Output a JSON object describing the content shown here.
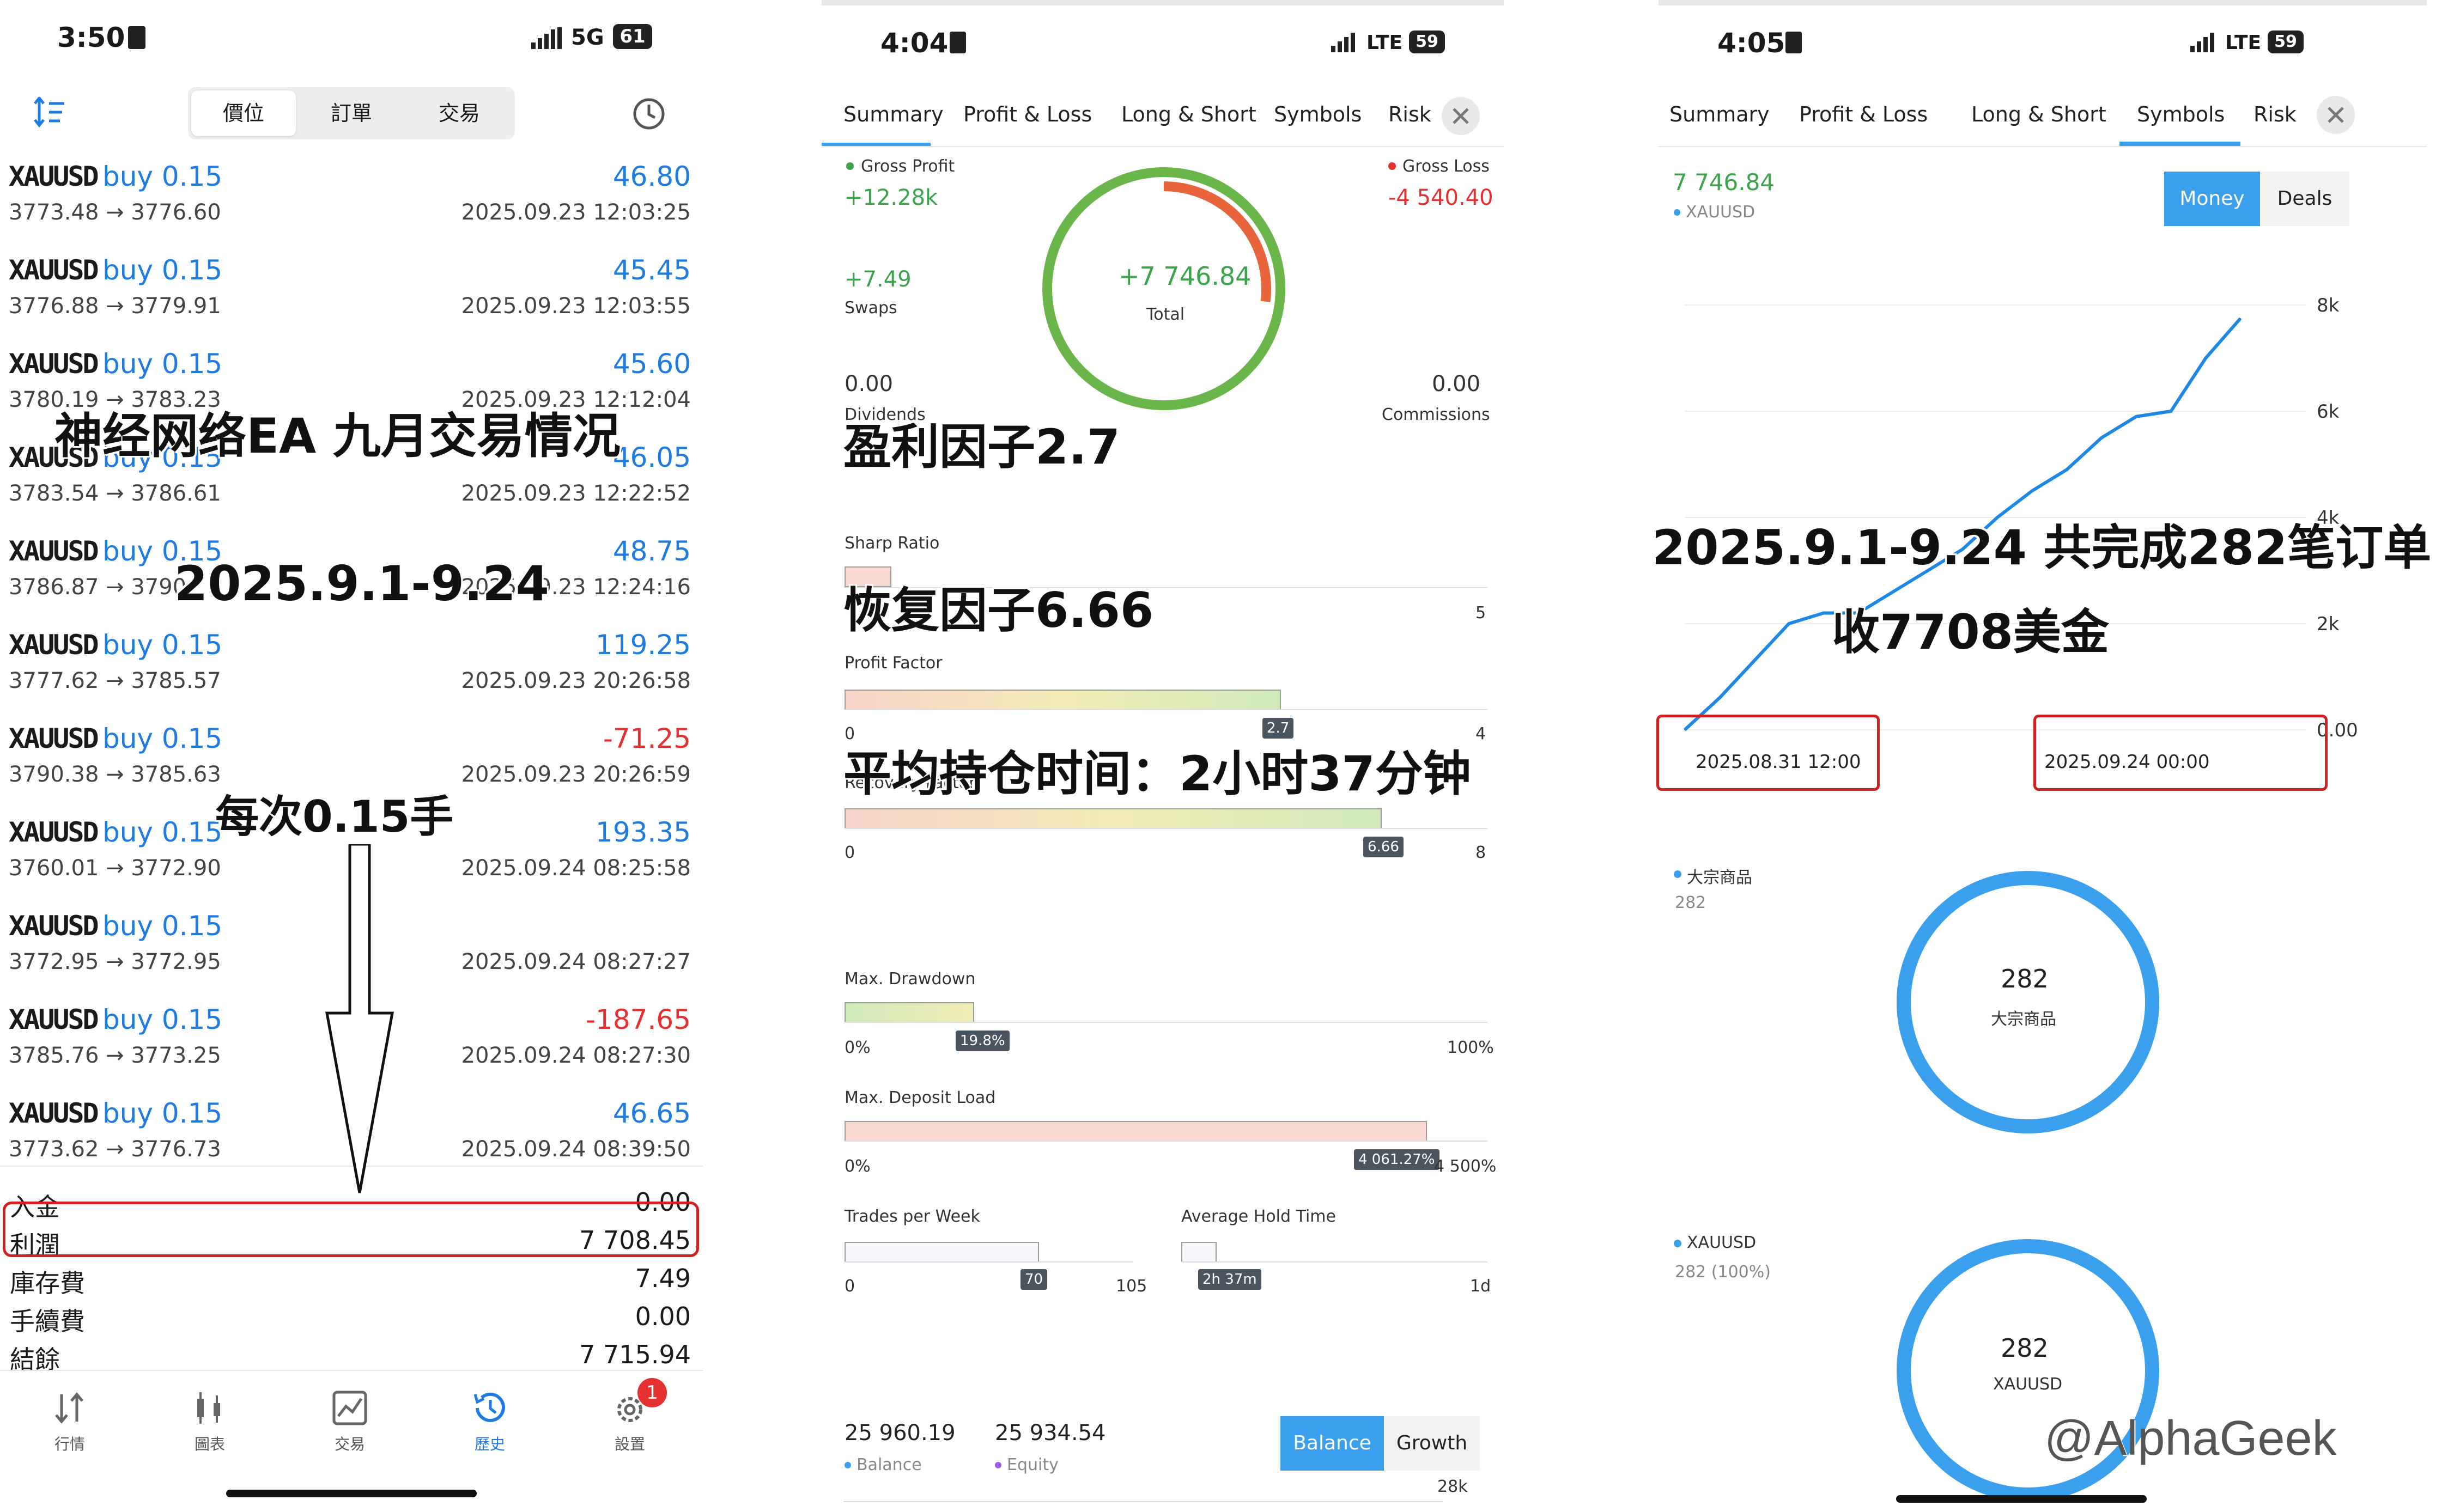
{
  "panel1": {
    "status": {
      "time": "3:50",
      "network": "5G",
      "battery": "61"
    },
    "segments": [
      "價位",
      "訂單",
      "交易"
    ],
    "trades": [
      {
        "symbol": "XAUUSD",
        "dir": "buy 0.15",
        "prices": "3773.48 → 3776.60",
        "profit": "46.80",
        "time": "2025.09.23 12:03:25",
        "neg": false
      },
      {
        "symbol": "XAUUSD",
        "dir": "buy 0.15",
        "prices": "3776.88 → 3779.91",
        "profit": "45.45",
        "time": "2025.09.23 12:03:55",
        "neg": false
      },
      {
        "symbol": "XAUUSD",
        "dir": "buy 0.15",
        "prices": "3780.19 → 3783.23",
        "profit": "45.60",
        "time": "2025.09.23 12:12:04",
        "neg": false
      },
      {
        "symbol": "XAUUSD",
        "dir": "buy 0.15",
        "prices": "3783.54 → 3786.61",
        "profit": "46.05",
        "time": "2025.09.23 12:22:52",
        "neg": false
      },
      {
        "symbol": "XAUUSD",
        "dir": "buy 0.15",
        "prices": "3786.87 → 3790.",
        "profit": "48.75",
        "time": "2025.09.23 12:24:16",
        "neg": false
      },
      {
        "symbol": "XAUUSD",
        "dir": "buy 0.15",
        "prices": "3777.62 → 3785.57",
        "profit": "119.25",
        "time": "2025.09.23 20:26:58",
        "neg": false
      },
      {
        "symbol": "XAUUSD",
        "dir": "buy 0.15",
        "prices": "3790.38 → 3785.63",
        "profit": "-71.25",
        "time": "2025.09.23 20:26:59",
        "neg": true
      },
      {
        "symbol": "XAUUSD",
        "dir": "buy 0.15",
        "prices": "3760.01 → 3772.90",
        "profit": "193.35",
        "time": "2025.09.24 08:25:58",
        "neg": false
      },
      {
        "symbol": "XAUUSD",
        "dir": "buy 0.15",
        "prices": "3772.95 → 3772.95",
        "profit": "",
        "time": "2025.09.24 08:27:27",
        "neg": false
      },
      {
        "symbol": "XAUUSD",
        "dir": "buy 0.15",
        "prices": "3785.76 → 3773.25",
        "profit": "-187.65",
        "time": "2025.09.24 08:27:30",
        "neg": true
      },
      {
        "symbol": "XAUUSD",
        "dir": "buy 0.15",
        "prices": "3773.62 → 3776.73",
        "profit": "46.65",
        "time": "2025.09.24 08:39:50",
        "neg": false
      }
    ],
    "summary": [
      {
        "label": "入金",
        "value": "0.00"
      },
      {
        "label": "利潤",
        "value": "7 708.45"
      },
      {
        "label": "庫存費",
        "value": "7.49"
      },
      {
        "label": "手續費",
        "value": "0.00"
      },
      {
        "label": "結餘",
        "value": "7 715.94"
      }
    ],
    "nav": [
      "行情",
      "圖表",
      "交易",
      "歷史",
      "設置"
    ],
    "nav_badge": "1",
    "overlay_title": "神经网络EA 九月交易情况",
    "overlay_dates": "2025.9.1-9.24",
    "overlay_lots": "每次0.15手"
  },
  "panel2": {
    "status": {
      "time": "4:04",
      "network": "LTE",
      "battery": "59"
    },
    "tabs": [
      "Summary",
      "Profit & Loss",
      "Long & Short",
      "Symbols",
      "Risk"
    ],
    "gross_profit_label": "Gross Profit",
    "gross_profit": "+12.28k",
    "gross_loss_label": "Gross Loss",
    "gross_loss": "-4 540.40",
    "swaps": "+7.49",
    "swaps_label": "Swaps",
    "dividends": "0.00",
    "dividends_label": "Dividends",
    "commissions": "0.00",
    "commissions_label": "Commissions",
    "total": "+7 746.84",
    "total_label": "Total",
    "sharp_label": "Sharp Ratio",
    "sharp_max": "5",
    "pf_label": "Profit Factor",
    "pf_value": "2.7",
    "pf_min": "0",
    "pf_max": "4",
    "rf_label": "Recovery Factor",
    "rf_value": "6.66",
    "rf_min": "0",
    "rf_max": "8",
    "dd_label": "Max. Drawdown",
    "dd_value": "19.8%",
    "dd_min": "0%",
    "dd_max": "100%",
    "dl_label": "Max. Deposit Load",
    "dl_value": "4 061.27%",
    "dl_min": "0%",
    "dl_max": "4 500%",
    "tpw_label": "Trades per Week",
    "tpw_value": "70",
    "tpw_min": "0",
    "tpw_max": "105",
    "aht_label": "Average Hold Time",
    "aht_value": "2h 37m",
    "aht_max": "1d",
    "balance": "25 960.19",
    "balance_label": "Balance",
    "equity": "25 934.54",
    "equity_label": "Equity",
    "btn_balance": "Balance",
    "btn_growth": "Growth",
    "axis_28k": "28k",
    "overlay_pf": "盈利因子2.7",
    "overlay_rf": "恢复因子6.66",
    "overlay_hold": "平均持仓时间：2小时37分钟",
    "levels": {
      "pf": 0.675,
      "rf": 0.8325,
      "dd": 0.198,
      "dl": 0.9025,
      "tpw": 0.6667,
      "aht": 0.109,
      "loss_arc": 0.27
    }
  },
  "panel3": {
    "status": {
      "time": "4:05",
      "network": "LTE",
      "battery": "59"
    },
    "tabs": [
      "Summary",
      "Profit & Loss",
      "Long & Short",
      "Symbols",
      "Risk"
    ],
    "value": "7 746.84",
    "legend": "XAUUSD",
    "btn_money": "Money",
    "btn_deals": "Deals",
    "y_ticks": [
      "8k",
      "6k",
      "4k",
      "2k",
      "0.00"
    ],
    "x_start": "2025.08.31 12:00",
    "x_end": "2025.09.24 00:00",
    "donut1_legend": "大宗商品",
    "donut1_sub": "282",
    "donut1_center": "282",
    "donut1_label": "大宗商品",
    "donut2_legend": "XAUUSD",
    "donut2_sub": "282 (100%)",
    "donut2_center": "282",
    "donut2_label": "XAUUSD",
    "overlay_line1": "2025.9.1-9.24 共完成282笔订单",
    "overlay_line2": "收7708美金",
    "watermark": "@AlphaGeek",
    "colors": {
      "accent": "#3aa0ee",
      "line": "#1e88e5"
    }
  },
  "chart_data": {
    "type": "line",
    "title": "",
    "x": [
      "2025.08.31 12:00",
      "2025.09.24 00:00"
    ],
    "series": [
      {
        "values": [
          0,
          600,
          1300,
          2000,
          2200,
          2200,
          2600,
          3000,
          3400,
          4000,
          4500,
          4900,
          5500,
          5900,
          6000,
          7000,
          7746.84
        ]
      }
    ],
    "ylim": [
      0,
      8000
    ],
    "yticks": [
      "8k",
      "6k",
      "4k",
      "2k",
      "0.00"
    ]
  }
}
